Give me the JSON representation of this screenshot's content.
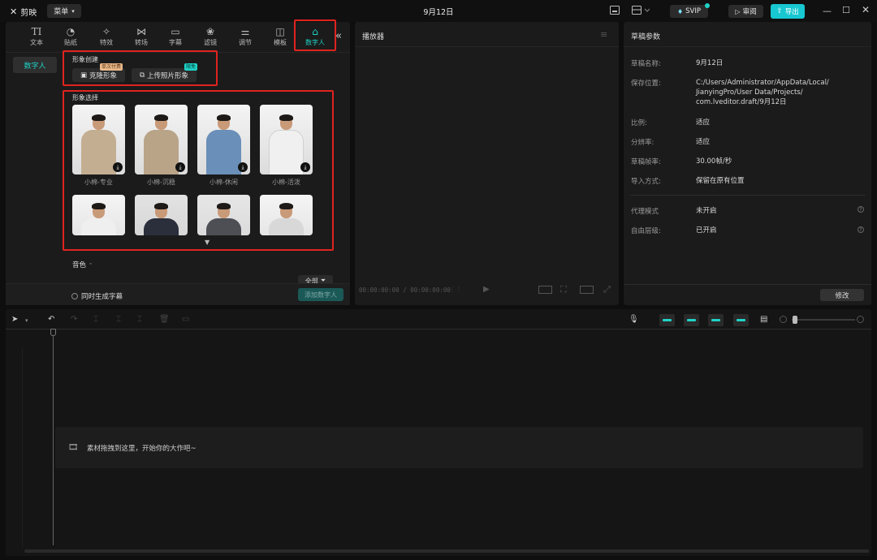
{
  "titlebar": {
    "app_name": "剪映",
    "menu_label": "菜单",
    "project_title": "9月12日",
    "svip_label": "SVIP",
    "review_label": "审阅",
    "export_label": "导出"
  },
  "toolbar": {
    "tabs": [
      {
        "label": "文本",
        "icon": "text-icon"
      },
      {
        "label": "贴纸",
        "icon": "sticker-icon"
      },
      {
        "label": "特效",
        "icon": "effects-icon"
      },
      {
        "label": "转场",
        "icon": "transition-icon"
      },
      {
        "label": "字幕",
        "icon": "subtitle-icon"
      },
      {
        "label": "滤镜",
        "icon": "filter-icon"
      },
      {
        "label": "调节",
        "icon": "adjust-icon"
      },
      {
        "label": "模板",
        "icon": "template-icon"
      },
      {
        "label": "数字人",
        "icon": "digital-human-icon"
      }
    ]
  },
  "left_panel": {
    "sidebar_item": "数字人",
    "create_section": {
      "title": "形象创建",
      "clone_button": "克隆形象",
      "clone_badge": "单次付费",
      "upload_button": "上传照片形象",
      "upload_badge": "限免"
    },
    "select_section": {
      "title": "形象选择",
      "avatars": [
        {
          "name": "小棉-专业"
        },
        {
          "name": "小棉-沉稳"
        },
        {
          "name": "小棉-休闲"
        },
        {
          "name": "小棉-活泼"
        }
      ]
    },
    "voice_label": "音色",
    "filter_all": "全部",
    "gen_subtitle_label": "同时生成字幕",
    "add_button": "添加数字人"
  },
  "player": {
    "title": "播放器",
    "timecode": "00:00:00:00 / 00:00:00:00"
  },
  "draft": {
    "title": "草稿参数",
    "rows": [
      {
        "key": "草稿名称:",
        "value": "9月12日"
      },
      {
        "key": "保存位置:",
        "value": "C:/Users/Administrator/AppData/Local/"
      },
      {
        "key": "比例:",
        "value": "适应"
      },
      {
        "key": "分辨率:",
        "value": "适应"
      },
      {
        "key": "草稿帧率:",
        "value": "30.00帧/秒"
      },
      {
        "key": "导入方式:",
        "value": "保留在原有位置"
      },
      {
        "key": "代理模式",
        "value": "未开启"
      },
      {
        "key": "自由层级:",
        "value": "已开启"
      }
    ],
    "save_path_lines": [
      "JianyingPro/User Data/Projects/",
      "com.lveditor.draft/9月12日"
    ],
    "modify_button": "修改"
  },
  "timeline": {
    "empty_hint": "素材拖拽到这里，开始你的大作吧~"
  },
  "colors": {
    "accent": "#1fd3c6",
    "highlight": "#e0231f",
    "panel": "#1b1b1b"
  }
}
